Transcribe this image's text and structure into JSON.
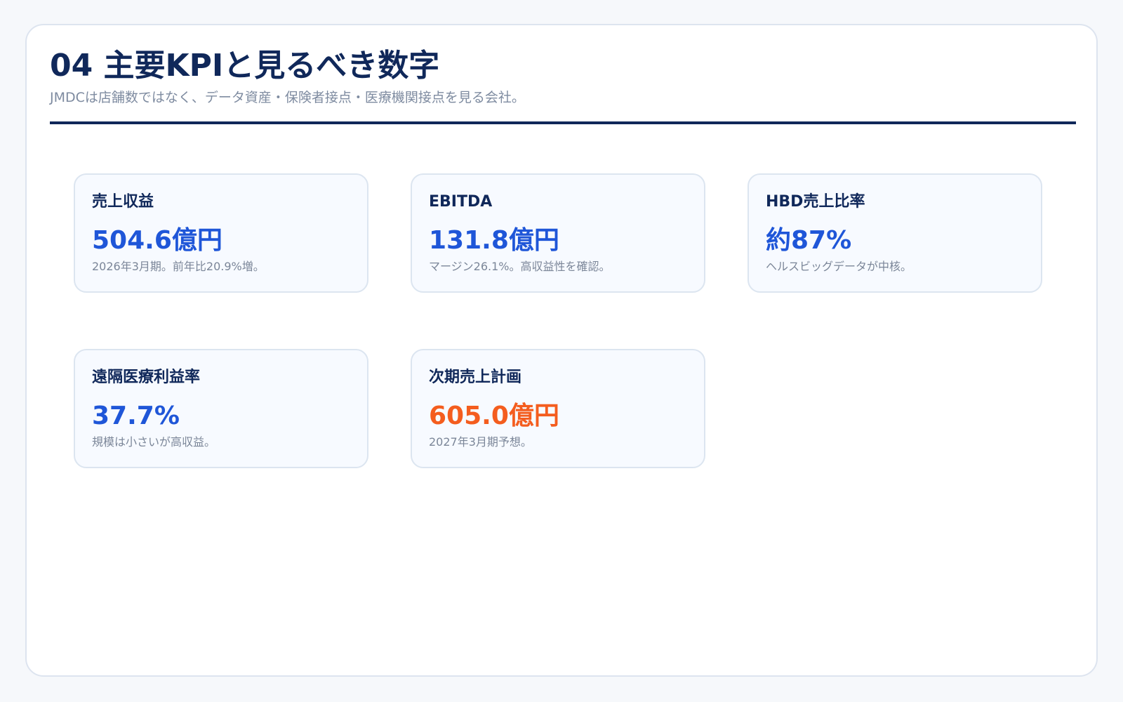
{
  "header": {
    "title": "04 主要KPIと見るべき数字",
    "subtitle": "JMDCは店舗数ではなく、データ資産・保険者接点・医療機関接点を見る会社。"
  },
  "colors": {
    "accent_blue": "#1f56d8",
    "accent_orange": "#f45d1e",
    "navy": "#10285a"
  },
  "kpis": [
    {
      "label": "売上収益",
      "value": "504.6億円",
      "note": "2026年3月期。前年比20.9%増。",
      "accent": "blue"
    },
    {
      "label": "EBITDA",
      "value": "131.8億円",
      "note": "マージン26.1%。高収益性を確認。",
      "accent": "blue"
    },
    {
      "label": "HBD売上比率",
      "value": "約87%",
      "note": "ヘルスビッグデータが中核。",
      "accent": "blue"
    },
    {
      "label": "遠隔医療利益率",
      "value": "37.7%",
      "note": "規模は小さいが高収益。",
      "accent": "blue"
    },
    {
      "label": "次期売上計画",
      "value": "605.0億円",
      "note": "2027年3月期予想。",
      "accent": "orange"
    }
  ]
}
